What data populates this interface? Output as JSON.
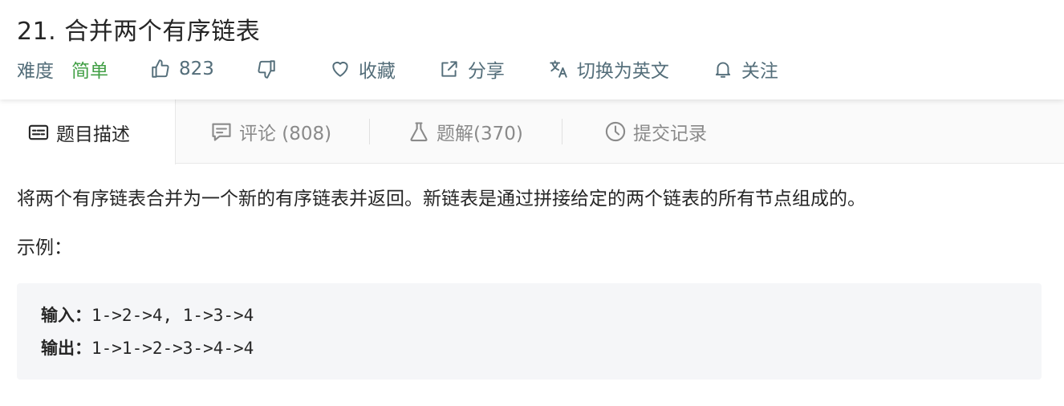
{
  "problem": {
    "title": "21. 合并两个有序链表"
  },
  "meta": {
    "difficulty_label": "难度",
    "difficulty_value": "简单",
    "likes": "823",
    "favorite_label": "收藏",
    "share_label": "分享",
    "translate_label": "切换为英文",
    "follow_label": "关注"
  },
  "tabs": [
    {
      "label": "题目描述",
      "icon": "description-icon",
      "active": true
    },
    {
      "label": "评论 (808)",
      "icon": "comment-icon"
    },
    {
      "label": "题解(370)",
      "icon": "flask-icon"
    },
    {
      "label": "提交记录",
      "icon": "clock-icon"
    }
  ],
  "content": {
    "description": "将两个有序链表合并为一个新的有序链表并返回。新链表是通过拼接给定的两个链表的所有节点组成的。",
    "example_label": "示例：",
    "input_label": "输入：",
    "input_value": "1->2->4, 1->3->4",
    "output_label": "输出：",
    "output_value": "1->1->2->3->4->4"
  },
  "colors": {
    "easy": "#43a047",
    "meta_text": "#546e7a",
    "code_bg": "#f5f6f8"
  }
}
